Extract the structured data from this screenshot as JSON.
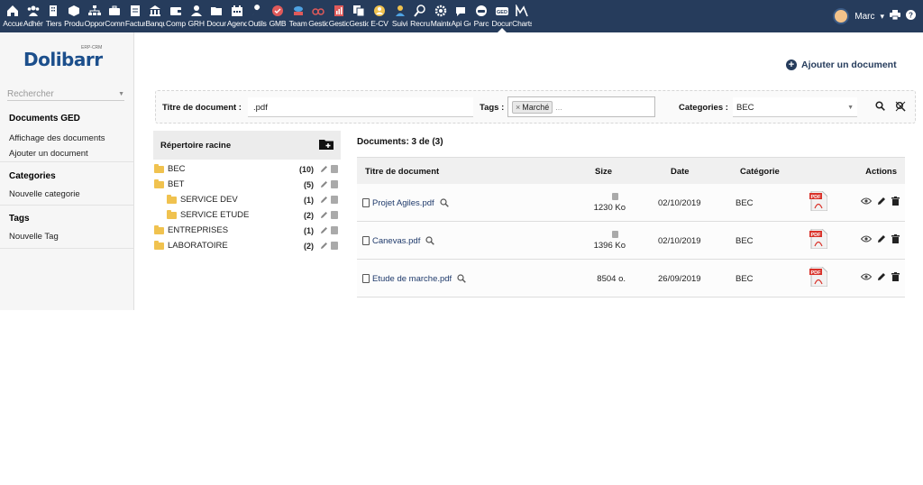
{
  "topbar": {
    "menu": [
      {
        "label": "Accueil",
        "icon": "home-icon",
        "color": "#ffffff"
      },
      {
        "label": "Adhérents",
        "icon": "users-icon",
        "color": "#ffffff"
      },
      {
        "label": "Tiers",
        "icon": "building-icon",
        "color": "#ffffff"
      },
      {
        "label": "Produits",
        "icon": "cube-icon",
        "color": "#ffffff"
      },
      {
        "label": "Opportunités",
        "icon": "sitemap-icon",
        "color": "#ffffff"
      },
      {
        "label": "Commercial",
        "icon": "suitcase-icon",
        "color": "#ffffff"
      },
      {
        "label": "Facturation",
        "icon": "invoice-icon",
        "color": "#ffffff"
      },
      {
        "label": "Banque",
        "icon": "bank-icon",
        "color": "#ffffff"
      },
      {
        "label": "Comptabilité",
        "icon": "wallet-icon",
        "color": "#ffffff"
      },
      {
        "label": "GRH",
        "icon": "person-icon",
        "color": "#ffffff"
      },
      {
        "label": "Documents",
        "icon": "folder-icon",
        "color": "#ffffff"
      },
      {
        "label": "Agenda",
        "icon": "calendar-icon",
        "color": "#ffffff"
      },
      {
        "label": "Outils",
        "icon": "wrench-icon",
        "color": "#ffffff"
      },
      {
        "label": "GMB",
        "icon": "gmb-badge-icon",
        "color": "#e05a5a"
      },
      {
        "label": "Team",
        "icon": "team-icon",
        "color": "#4fa3e3"
      },
      {
        "label": "Gestion",
        "icon": "glasses-icon",
        "color": "#e05a5a"
      },
      {
        "label": "Gestion",
        "icon": "chart-doc-icon",
        "color": "#e05a5a"
      },
      {
        "label": "Gestion",
        "icon": "copy-icon",
        "color": "#ffffff"
      },
      {
        "label": "E-CV",
        "icon": "person-badge-icon",
        "color": "#f0c24f"
      },
      {
        "label": "Suivi",
        "icon": "person-tie-icon",
        "color": "#f0c24f"
      },
      {
        "label": "Recrutement",
        "icon": "magnifier-person-icon",
        "color": "#ffffff"
      },
      {
        "label": "Maintenance",
        "icon": "cog-icon",
        "color": "#ffffff"
      },
      {
        "label": "Api Google",
        "icon": "api-icon",
        "color": "#ffffff"
      },
      {
        "label": "Parc",
        "icon": "car-icon",
        "color": "#ffffff"
      },
      {
        "label": "Documents GED",
        "icon": "ged-icon",
        "color": "#ffffff"
      },
      {
        "label": "Charts",
        "icon": "m-chart-icon",
        "color": "#ffffff"
      }
    ],
    "active_index": 24,
    "user": "Marc"
  },
  "sidebar": {
    "brand": "Dolibarr",
    "brand_tag": "ERP-CRM",
    "search_placeholder": "Rechercher",
    "groups": [
      {
        "title": "Documents GED",
        "items": [
          "Affichage des documents",
          "Ajouter un document"
        ]
      },
      {
        "title": "Categories",
        "items": [
          "Nouvelle categorie"
        ]
      },
      {
        "title": "Tags",
        "items": [
          "Nouvelle Tag"
        ]
      }
    ]
  },
  "add_document_label": "Ajouter un document",
  "filter": {
    "title_label": "Titre de document :",
    "title_value": ".pdf",
    "tags_label": "Tags :",
    "tags": [
      "Marché"
    ],
    "tags_more": "...",
    "categories_label": "Categories :",
    "category_value": "BEC"
  },
  "tree": {
    "header": "Répertoire racine",
    "folders": [
      {
        "name": "BEC",
        "count": "(10)",
        "level": 0
      },
      {
        "name": "BET",
        "count": "(5)",
        "level": 0
      },
      {
        "name": "SERVICE DEV",
        "count": "(1)",
        "level": 1
      },
      {
        "name": "SERVICE ETUDE",
        "count": "(2)",
        "level": 1
      },
      {
        "name": "ENTREPRISES",
        "count": "(1)",
        "level": 0
      },
      {
        "name": "LABORATOIRE",
        "count": "(2)",
        "level": 0
      }
    ]
  },
  "documents": {
    "summary": "Documents: 3 de (3)",
    "columns": [
      "Titre de document",
      "Size",
      "Date",
      "Catégorie",
      "Actions"
    ],
    "rows": [
      {
        "name": "Projet Agiles.pdf",
        "size": "1230 Ko",
        "date": "02/10/2019",
        "category": "BEC",
        "size_icon": true
      },
      {
        "name": "Canevas.pdf",
        "size": "1396 Ko",
        "date": "02/10/2019",
        "category": "BEC",
        "size_icon": true
      },
      {
        "name": "Etude de marche.pdf",
        "size": "8504 o.",
        "date": "26/09/2019",
        "category": "BEC",
        "size_icon": false
      }
    ]
  },
  "colors": {
    "topbar": "#263c5c",
    "link": "#1f3a6b",
    "pdf": "#d9322a",
    "folder": "#f0c24f"
  }
}
